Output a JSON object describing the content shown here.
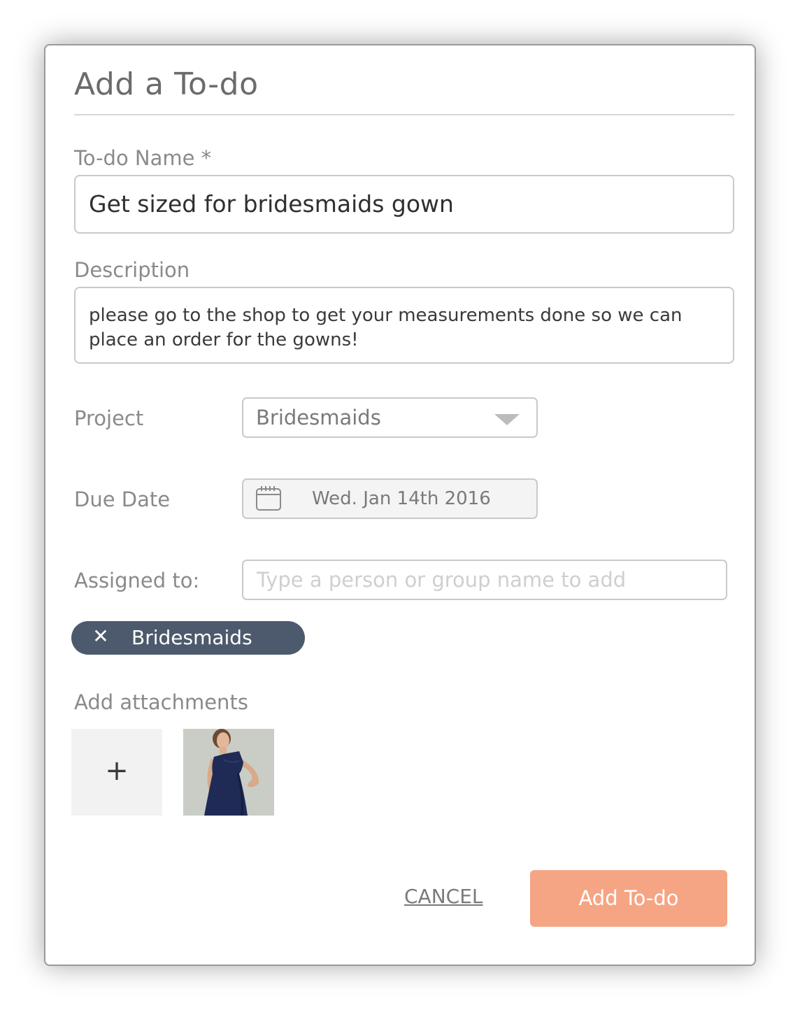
{
  "dialog": {
    "title": "Add a To-do"
  },
  "fields": {
    "name_label": "To-do Name *",
    "name_value": "Get sized for bridesmaids gown",
    "description_label": "Description",
    "description_value": "please go to the shop to get your measurements done so we can place an order for the gowns!",
    "project_label": "Project",
    "project_value": "Bridesmaids",
    "due_date_label": "Due Date",
    "due_date_value": "Wed. Jan 14th 2016",
    "assigned_label": "Assigned to:",
    "assigned_placeholder": "Type a person or group name to add",
    "assigned_chips": [
      {
        "label": "Bridesmaids",
        "remove_glyph": "✕"
      }
    ]
  },
  "attachments": {
    "label": "Add attachments",
    "add_glyph": "+",
    "items": [
      {
        "kind": "image",
        "icon": "gown-thumbnail"
      }
    ]
  },
  "actions": {
    "cancel_label": "CANCEL",
    "submit_label": "Add To-do"
  },
  "colors": {
    "accent": "#f5a583",
    "chip": "#4d5a6d",
    "border": "#c9c9c9",
    "label": "#8a8a8a"
  },
  "icons": {
    "calendar": "calendar-icon",
    "dropdown": "chevron-down-icon",
    "remove": "close-icon",
    "add": "plus-icon"
  }
}
